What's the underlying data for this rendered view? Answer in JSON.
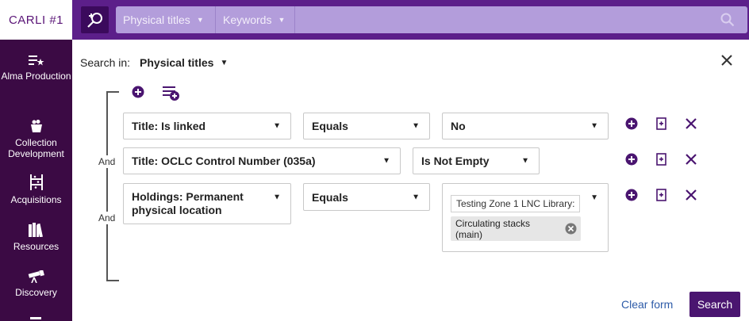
{
  "app": {
    "logo_text": "CARLI #1"
  },
  "nav": [
    {
      "label": "Alma Production",
      "icon": "alma-production-icon"
    },
    {
      "label": "Collection Development",
      "icon": "collection-development-icon"
    },
    {
      "label": "Acquisitions",
      "icon": "acquisitions-icon"
    },
    {
      "label": "Resources",
      "icon": "resources-icon"
    },
    {
      "label": "Discovery",
      "icon": "discovery-icon"
    }
  ],
  "topbar": {
    "scope_label": "Physical titles",
    "field_label": "Keywords"
  },
  "panel": {
    "search_in_label": "Search in:",
    "search_in_value": "Physical titles",
    "and_label": "And",
    "rows": [
      {
        "field": "Title: Is linked",
        "operator": "Equals",
        "value": "No"
      },
      {
        "field": "Title: OCLC Control Number (035a)",
        "operator": "Is Not Empty"
      },
      {
        "field": "Holdings: Permanent physical location",
        "operator": "Equals",
        "value_text": "Testing Zone 1 LNC Library:",
        "value_chip": "Circulating stacks (main)"
      }
    ],
    "clear_label": "Clear form",
    "search_label": "Search"
  },
  "colors": {
    "rail": "#3b0a44",
    "topbar": "#5c1f8a",
    "accent": "#4a1570",
    "link": "#2d5ba8"
  }
}
